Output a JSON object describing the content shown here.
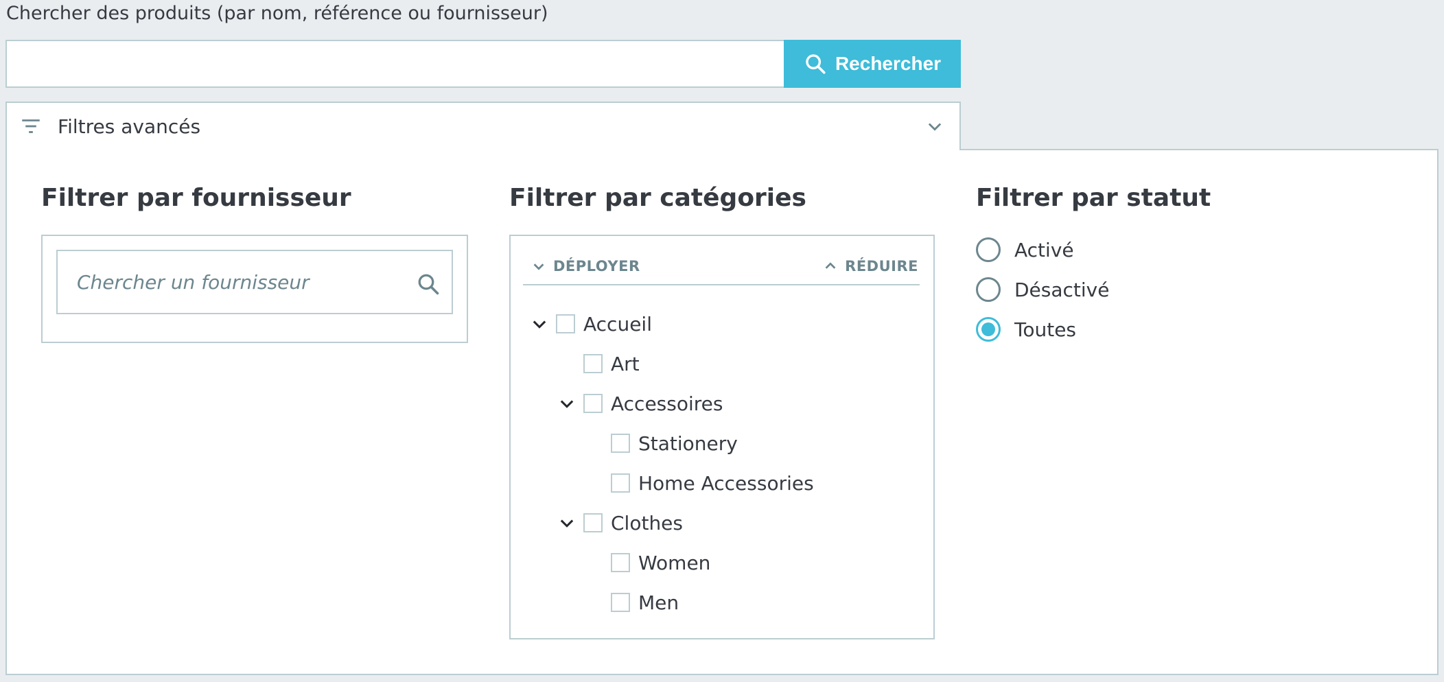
{
  "search": {
    "label": "Chercher des produits (par nom, référence ou fournisseur)",
    "value": "",
    "button_label": "Rechercher"
  },
  "filters": {
    "toggle_label": "Filtres avancés"
  },
  "supplier": {
    "title": "Filtrer par fournisseur",
    "placeholder": "Chercher un fournisseur"
  },
  "categories": {
    "title": "Filtrer par catégories",
    "expand_label": "DÉPLOYER",
    "collapse_label": "RÉDUIRE",
    "tree": [
      {
        "label": "Accueil",
        "expanded": true,
        "checked": false
      },
      {
        "label": "Art",
        "checked": false
      },
      {
        "label": "Accessoires",
        "expanded": true,
        "checked": false
      },
      {
        "label": "Stationery",
        "checked": false
      },
      {
        "label": "Home Accessories",
        "checked": false
      },
      {
        "label": "Clothes",
        "expanded": true,
        "checked": false
      },
      {
        "label": "Women",
        "checked": false
      },
      {
        "label": "Men",
        "checked": false
      }
    ]
  },
  "status": {
    "title": "Filtrer par statut",
    "options": [
      {
        "label": "Activé",
        "checked": false
      },
      {
        "label": "Désactivé",
        "checked": false
      },
      {
        "label": "Toutes",
        "checked": true
      }
    ]
  },
  "colors": {
    "accent": "#3ebcd9",
    "border": "#bbcdd2",
    "text": "#363a41",
    "muted": "#6c868e",
    "background": "#eaedf0"
  }
}
